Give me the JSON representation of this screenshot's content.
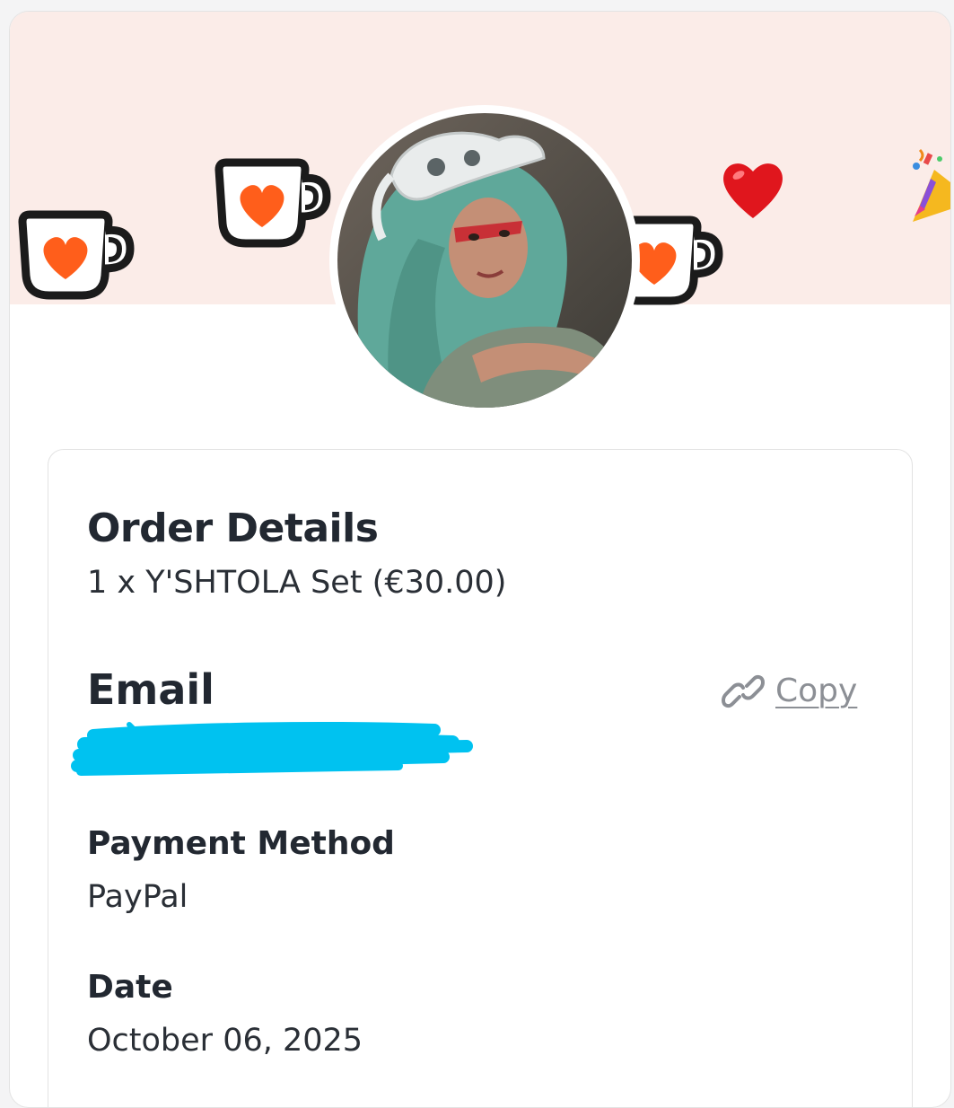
{
  "banner": {
    "background": "#fbece8",
    "decorations": [
      "coffee-cup-heart-icon",
      "coffee-cup-heart-icon",
      "coffee-cup-heart-icon",
      "red-heart-emoji",
      "party-popper-emoji"
    ]
  },
  "avatar": {
    "subject": "profile-photo"
  },
  "order": {
    "heading": "Order Details",
    "item": "1 x Y'SHTOLA Set (€30.00)"
  },
  "email": {
    "heading": "Email",
    "copy_label": "Copy",
    "value_redacted": true
  },
  "payment": {
    "heading": "Payment Method",
    "value": "PayPal"
  },
  "date": {
    "heading": "Date",
    "value": "October 06, 2025"
  },
  "colors": {
    "cup_heart": "#ff5e1b",
    "cup_outline": "#1b1b1b",
    "redaction": "#00c2f0",
    "link": "#8c8f95"
  }
}
